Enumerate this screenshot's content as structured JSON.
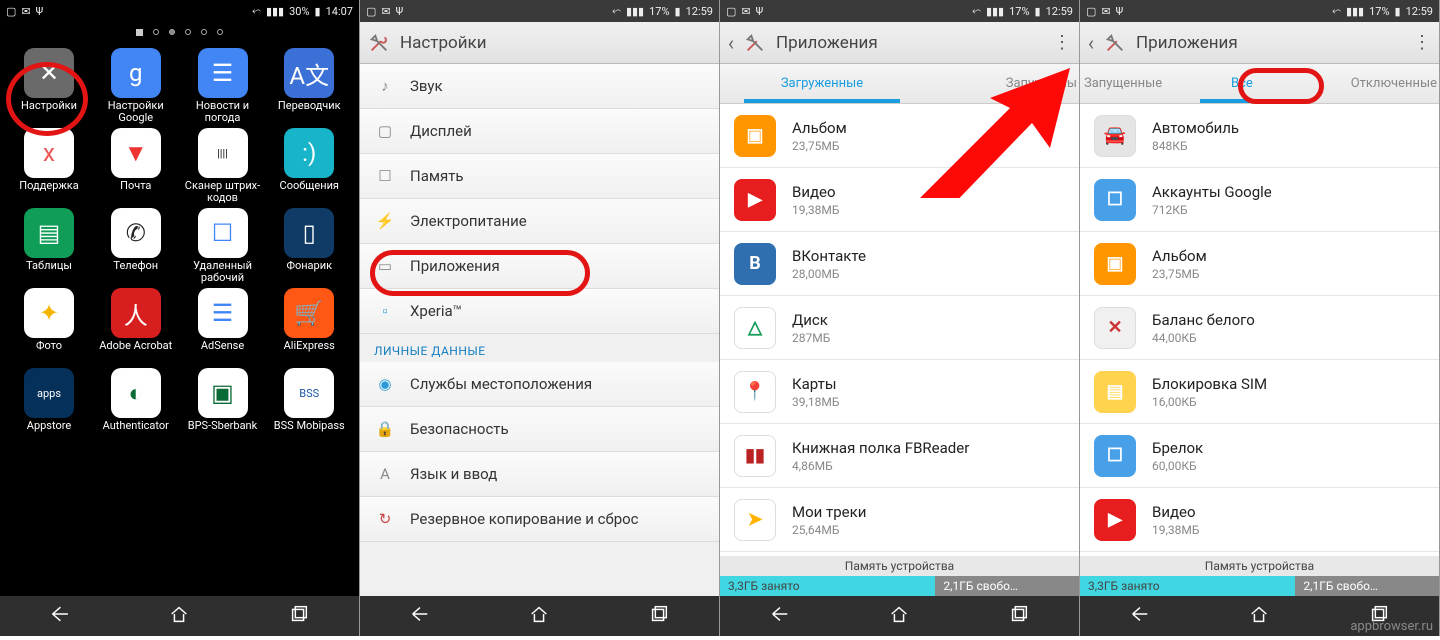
{
  "watermark": "appbrowser.ru",
  "screen1": {
    "status": {
      "battery": "30%",
      "time": "14:07"
    },
    "apps": [
      {
        "label": "Настройки",
        "color": "#6a6a6a",
        "glyph": "✕"
      },
      {
        "label": "Настройки Google",
        "color": "#4285f4",
        "glyph": "g"
      },
      {
        "label": "Новости и погода",
        "color": "#4285f4",
        "glyph": "☰"
      },
      {
        "label": "Переводчик",
        "color": "#3b71d6",
        "glyph": "A文"
      },
      {
        "label": "Поддержка",
        "color": "#fff",
        "glyph": "x",
        "fg": "#e55"
      },
      {
        "label": "Почта",
        "color": "#fff",
        "glyph": "▼",
        "fg": "#e33"
      },
      {
        "label": "Сканер штрих-кодов",
        "color": "#fff",
        "glyph": "||||",
        "fg": "#111"
      },
      {
        "label": "Сообщения",
        "color": "#18b4c9",
        "glyph": ":)"
      },
      {
        "label": "Таблицы",
        "color": "#0f9d58",
        "glyph": "▤"
      },
      {
        "label": "Телефон",
        "color": "#fff",
        "glyph": "✆",
        "fg": "#222"
      },
      {
        "label": "Удаленный рабочий",
        "color": "#fff",
        "glyph": "☐",
        "fg": "#4285f4"
      },
      {
        "label": "Фонарик",
        "color": "#0f3b66",
        "glyph": "▯"
      },
      {
        "label": "Фото",
        "color": "#fff",
        "glyph": "✦",
        "fg": "#f4b400"
      },
      {
        "label": "Adobe Acrobat",
        "color": "#d71f1f",
        "glyph": "人"
      },
      {
        "label": "AdSense",
        "color": "#fff",
        "glyph": "☰",
        "fg": "#4285f4"
      },
      {
        "label": "AliExpress",
        "color": "#ff5814",
        "glyph": "🛒"
      },
      {
        "label": "Appstore",
        "color": "#04305a",
        "glyph": "apps"
      },
      {
        "label": "Authenticator",
        "color": "#fff",
        "glyph": "◐",
        "fg": "#0b6b36"
      },
      {
        "label": "BPS-Sberbank",
        "color": "#fff",
        "glyph": "▣",
        "fg": "#0b6b36"
      },
      {
        "label": "BSS Mobipass",
        "color": "#fff",
        "glyph": "BSS",
        "fg": "#1756a5"
      }
    ]
  },
  "screen2": {
    "status": {
      "battery": "17%",
      "time": "12:59"
    },
    "header": {
      "title": "Настройки"
    },
    "items": [
      {
        "label": "Звук",
        "icon": "eq"
      },
      {
        "label": "Дисплей",
        "icon": "display"
      },
      {
        "label": "Память",
        "icon": "storage"
      },
      {
        "label": "Электропитание",
        "icon": "power"
      },
      {
        "label": "Приложения",
        "icon": "apps"
      },
      {
        "label": "Xperia™",
        "icon": "xperia"
      }
    ],
    "section": "ЛИЧНЫЕ ДАННЫЕ",
    "items2": [
      {
        "label": "Службы местоположения",
        "icon": "location"
      },
      {
        "label": "Безопасность",
        "icon": "security"
      },
      {
        "label": "Язык и ввод",
        "icon": "lang"
      },
      {
        "label": "Резервное копирование и сброс",
        "icon": "backup"
      }
    ]
  },
  "screen3": {
    "status": {
      "battery": "17%",
      "time": "12:59"
    },
    "header": {
      "title": "Приложения"
    },
    "tabs": {
      "active": "Загруженные",
      "partial": "Запущенны"
    },
    "apps": [
      {
        "name": "Альбом",
        "size": "23,75МБ",
        "color": "#ff9600",
        "glyph": "▣"
      },
      {
        "name": "Видео",
        "size": "19,38МБ",
        "color": "#e81d1d",
        "glyph": "▶"
      },
      {
        "name": "ВКонтакте",
        "size": "28,00МБ",
        "color": "#2f6fb0",
        "glyph": "B"
      },
      {
        "name": "Диск",
        "size": "287МБ",
        "color": "#fff",
        "glyph": "△",
        "fg": "#0f9d58"
      },
      {
        "name": "Карты",
        "size": "39,18МБ",
        "color": "#fff",
        "glyph": "📍",
        "fg": "#e33"
      },
      {
        "name": "Книжная полка FBReader",
        "size": "4,86МБ",
        "color": "#fff",
        "glyph": "▮▮",
        "fg": "#b22"
      },
      {
        "name": "Мои треки",
        "size": "25,64МБ",
        "color": "#fff",
        "glyph": "➤",
        "fg": "#ffb300"
      }
    ],
    "storage": {
      "label": "Память устройства",
      "used": "3,3ГБ занято",
      "free": "2,1ГБ свобо…"
    }
  },
  "screen4": {
    "status": {
      "battery": "17%",
      "time": "12:59"
    },
    "header": {
      "title": "Приложения"
    },
    "tabs": {
      "left": "Запущенные",
      "active": "Все",
      "right": "Отключенные"
    },
    "apps": [
      {
        "name": "Автомобиль",
        "size": "848КБ",
        "color": "#e5e5e5",
        "glyph": "🚘",
        "fg": "#888"
      },
      {
        "name": "Аккаунты Google",
        "size": "712КБ",
        "color": "#47a0e8",
        "glyph": "☐"
      },
      {
        "name": "Альбом",
        "size": "23,75МБ",
        "color": "#ff9600",
        "glyph": "▣"
      },
      {
        "name": "Баланс белого",
        "size": "44,00КБ",
        "color": "#f0f0f0",
        "glyph": "✕",
        "fg": "#c33"
      },
      {
        "name": "Блокировка SIM",
        "size": "16,00КБ",
        "color": "#ffd34d",
        "glyph": "▤"
      },
      {
        "name": "Брелок",
        "size": "60,00КБ",
        "color": "#47a0e8",
        "glyph": "☐"
      },
      {
        "name": "Видео",
        "size": "19,38МБ",
        "color": "#e81d1d",
        "glyph": "▶"
      }
    ],
    "storage": {
      "label": "Память устройства",
      "used": "3,3ГБ занято",
      "free": "2,1ГБ свобо…"
    }
  }
}
